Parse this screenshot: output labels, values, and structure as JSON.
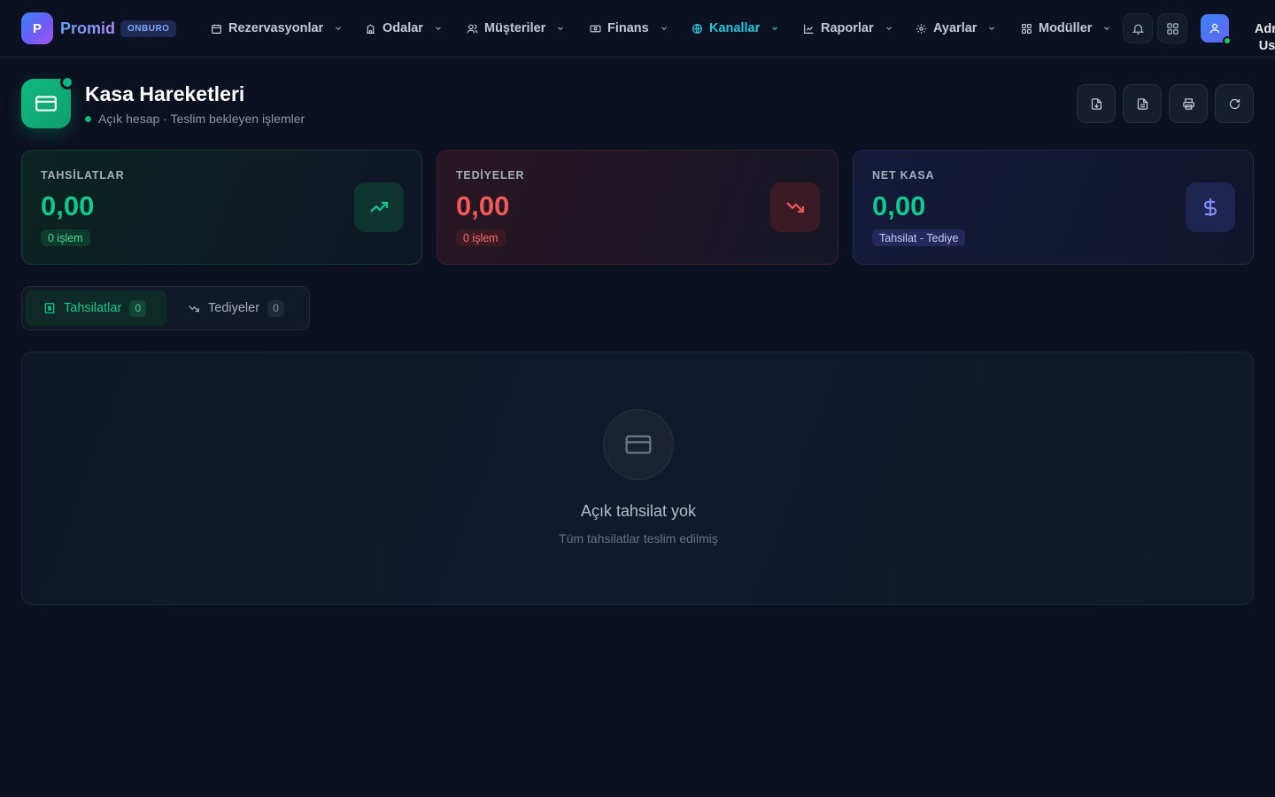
{
  "app": {
    "logo_letter": "P",
    "name": "Promid",
    "badge": "ONBURO"
  },
  "nav": {
    "items": [
      {
        "label": "Rezervasyonlar",
        "icon": "calendar-icon"
      },
      {
        "label": "Odalar",
        "icon": "building-icon"
      },
      {
        "label": "Müşteriler",
        "icon": "users-icon"
      },
      {
        "label": "Finans",
        "icon": "banknote-icon"
      },
      {
        "label": "Kanallar",
        "icon": "globe-icon",
        "active": true
      },
      {
        "label": "Raporlar",
        "icon": "chart-icon"
      },
      {
        "label": "Ayarlar",
        "icon": "gear-icon"
      },
      {
        "label": "Modüller",
        "icon": "grid-icon"
      }
    ],
    "active_color": "#22c5dc"
  },
  "user": {
    "name": "Admin",
    "role": "User",
    "status_color": "#22c55e"
  },
  "page": {
    "title": "Kasa Hareketleri",
    "subtitle": "Açık hesap · Teslim bekleyen işlemler"
  },
  "actions": [
    {
      "name": "export-file-button",
      "icon": "file-download-icon"
    },
    {
      "name": "report-button",
      "icon": "file-text-icon"
    },
    {
      "name": "print-button",
      "icon": "printer-icon"
    },
    {
      "name": "refresh-button",
      "icon": "refresh-icon"
    }
  ],
  "stats": {
    "collections": {
      "label": "TAHSİLATLAR",
      "value": "0,00",
      "badge": "0 işlem",
      "color": "#10c98b"
    },
    "payments": {
      "label": "TEDİYELER",
      "value": "0,00",
      "badge": "0 işlem",
      "color": "#f25a5a"
    },
    "net": {
      "label": "NET KASA",
      "value": "0,00",
      "badge": "Tahsilat - Tediye",
      "color": "#10c98b"
    }
  },
  "tabs": [
    {
      "label": "Tahsilatlar",
      "count": "0",
      "active": true
    },
    {
      "label": "Tediyeler",
      "count": "0",
      "active": false
    }
  ],
  "empty_state": {
    "title": "Açık tahsilat yok",
    "text": "Tüm tahsilatlar teslim edilmiş"
  }
}
